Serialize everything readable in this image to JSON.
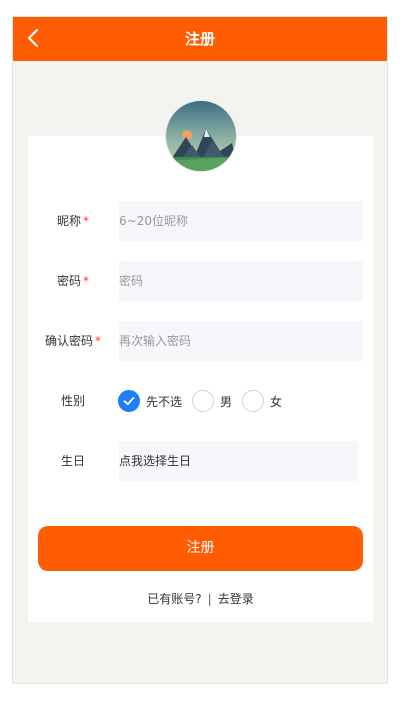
{
  "header": {
    "title": "注册",
    "background_color": "#ff5c03"
  },
  "avatar": {
    "icon": "mountain-landscape-avatar"
  },
  "form": {
    "nickname": {
      "label": "昵称",
      "required_mark": "*",
      "placeholder": "6~20位昵称",
      "value": ""
    },
    "password": {
      "label": "密码",
      "required_mark": "*",
      "placeholder": "密码",
      "value": ""
    },
    "confirm_password": {
      "label": "确认密码",
      "required_mark": "*",
      "placeholder": "再次输入密码",
      "value": ""
    },
    "gender": {
      "label": "性别",
      "options": [
        "先不选",
        "男",
        "女"
      ],
      "selected": "先不选"
    },
    "birthday": {
      "label": "生日",
      "value": "点我选择生日"
    }
  },
  "submit_label": "注册",
  "footer": {
    "prompt": "已有账号?",
    "separator": "|",
    "login_link": "去登录"
  },
  "colors": {
    "accent": "#ff5c03",
    "radio_checked": "#1f7ef5",
    "required": "#ff3b30",
    "field_bg": "#f6f7fb",
    "page_bg": "#f3f3f0"
  }
}
